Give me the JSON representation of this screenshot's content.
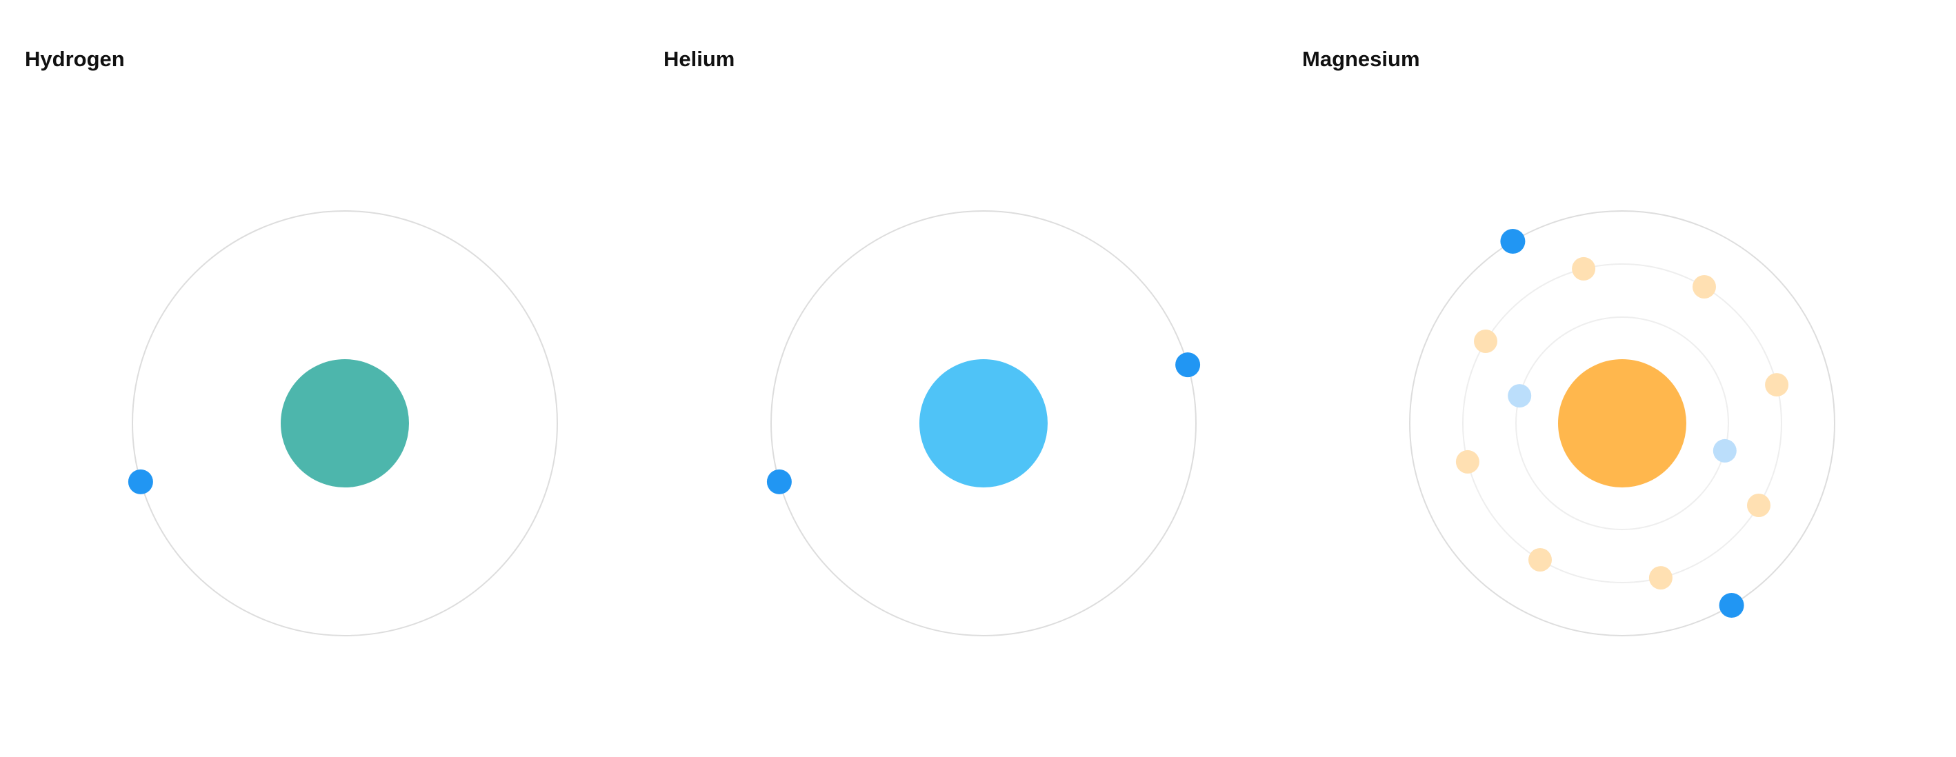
{
  "atoms": [
    {
      "name": "Hydrogen",
      "nucleus_color": "#4db6ac",
      "shells": [
        {
          "electrons": 1,
          "phase_deg": 164,
          "active": true
        }
      ]
    },
    {
      "name": "Helium",
      "nucleus_color": "#4fc3f7",
      "shells": [
        {
          "electrons": 2,
          "phase_deg": 164,
          "active": true
        }
      ]
    },
    {
      "name": "Magnesium",
      "nucleus_color": "#ffb74d",
      "shells": [
        {
          "electrons": 2,
          "phase_deg": 15,
          "active": false
        },
        {
          "electrons": 8,
          "phase_deg": 76,
          "active": false
        },
        {
          "electrons": 2,
          "phase_deg": 59,
          "active": true
        }
      ]
    }
  ],
  "colors": {
    "electron_active": "#2196f3",
    "electron_inner_shells": [
      "#bbdefb",
      "#ffe0b2"
    ],
    "orbit_active": "#dddddd",
    "orbit_inactive": "#eeeeee"
  }
}
